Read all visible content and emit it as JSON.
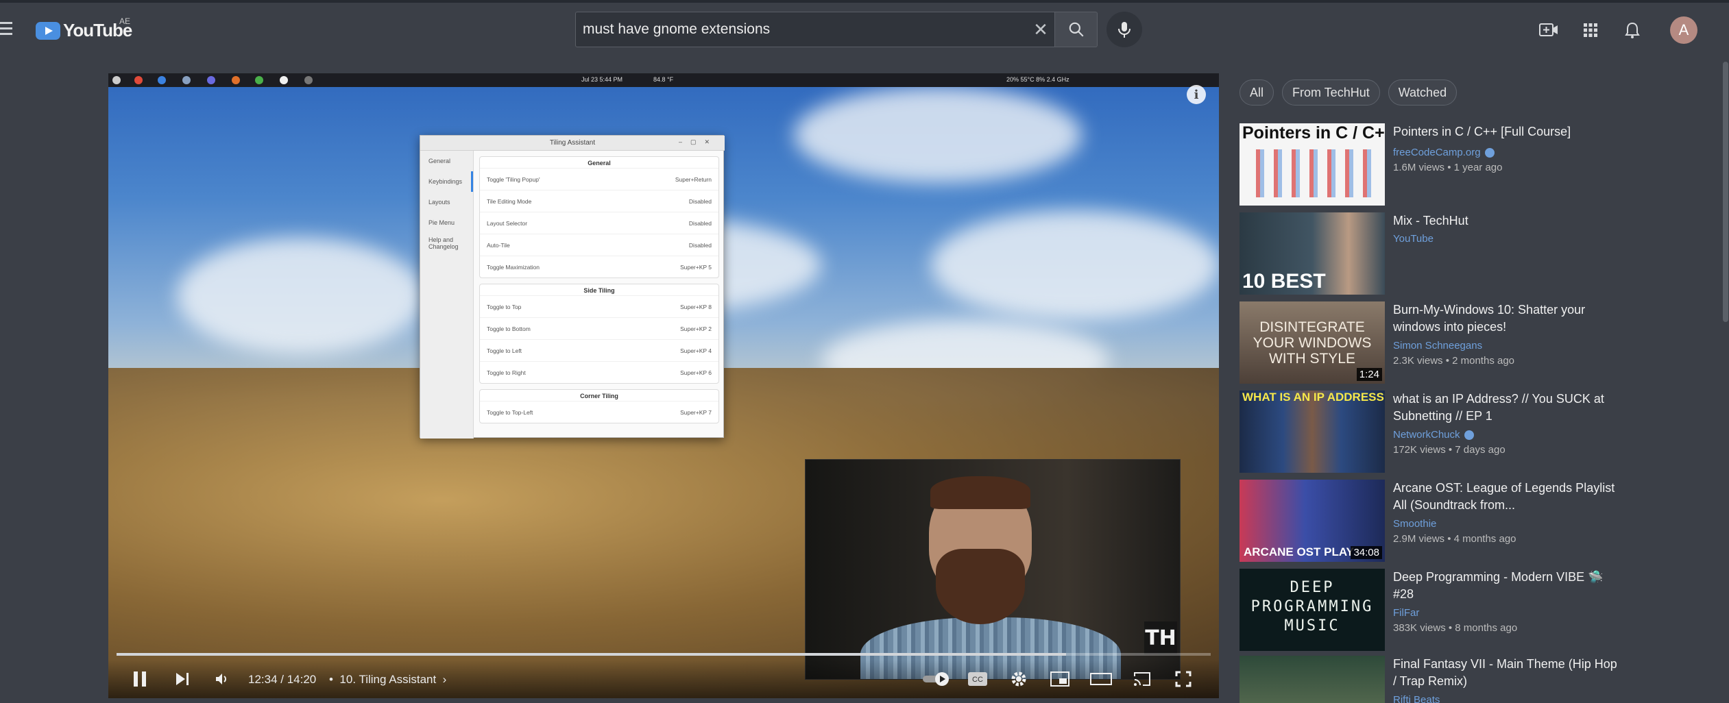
{
  "header": {
    "logo_text": "YouTube",
    "country_code": "AE",
    "search_query": "must have gnome extensions",
    "avatar_letter": "A",
    "icons": [
      "menu-icon",
      "search-icon",
      "clear-icon",
      "mic-icon",
      "create-icon",
      "apps-icon",
      "notifications-icon"
    ]
  },
  "video": {
    "desktop_bar": {
      "clock": "Jul 23  5:44 PM",
      "weather": "84.8 °F",
      "stats": "20%   55°C   8%   2.4 GHz"
    },
    "tiling_window": {
      "title": "Tiling Assistant",
      "nav": [
        "General",
        "Keybindings",
        "Layouts",
        "Pie Menu",
        "Help and Changelog"
      ],
      "sections": [
        {
          "heading": "General",
          "rows": [
            {
              "label": "Toggle 'Tiling Popup'",
              "value": "Super+Return"
            },
            {
              "label": "Tile Editing Mode",
              "value": "Disabled"
            },
            {
              "label": "Layout Selector",
              "value": "Disabled"
            },
            {
              "label": "Auto-Tile",
              "value": "Disabled"
            },
            {
              "label": "Toggle Maximization",
              "value": "Super+KP 5"
            }
          ]
        },
        {
          "heading": "Side Tiling",
          "rows": [
            {
              "label": "Toggle to Top",
              "value": "Super+KP 8"
            },
            {
              "label": "Toggle to Bottom",
              "value": "Super+KP 2"
            },
            {
              "label": "Toggle to Left",
              "value": "Super+KP 4"
            },
            {
              "label": "Toggle to Right",
              "value": "Super+KP 6"
            }
          ]
        },
        {
          "heading": "Corner Tiling",
          "rows": [
            {
              "label": "Toggle to Top-Left",
              "value": "Super+KP 7"
            }
          ]
        }
      ]
    },
    "watermark": "TH",
    "progress_fraction": 0.868,
    "time": "12:34 / 14:20",
    "chapter": "10. Tiling Assistant"
  },
  "chips": [
    "All",
    "From TechHut",
    "Watched"
  ],
  "recommendations": [
    {
      "title": "Pointers in C / C++ [Full Course]",
      "channel": "freeCodeCamp.org",
      "verified": true,
      "meta": "1.6M views • 1 year ago",
      "duration": "",
      "thumb_text": "Pointers in C / C++"
    },
    {
      "title": "Mix - TechHut",
      "channel": "YouTube",
      "verified": false,
      "meta": "",
      "duration": "",
      "thumb_text": "10 BEST"
    },
    {
      "title": "Burn-My-Windows 10: Shatter your windows into pieces!",
      "channel": "Simon Schneegans",
      "verified": false,
      "meta": "2.3K views • 2 months ago",
      "duration": "1:24",
      "thumb_text": "DISINTEGRATE YOUR WINDOWS WITH STYLE"
    },
    {
      "title": "what is an IP Address? // You SUCK at Subnetting // EP 1",
      "channel": "NetworkChuck",
      "verified": true,
      "meta": "172K views • 7 days ago",
      "duration": "",
      "thumb_text": "WHAT IS AN IP ADDRESS?"
    },
    {
      "title": "Arcane OST: League of Legends Playlist All (Soundtrack from...",
      "channel": "Smoothie",
      "verified": false,
      "meta": "2.9M views • 4 months ago",
      "duration": "34:08",
      "thumb_text": "ARCANE OST PLAY"
    },
    {
      "title": "Deep Programming - Modern VIBE 🛸 #28",
      "channel": "FilFar",
      "verified": false,
      "meta": "383K views • 8 months ago",
      "duration": "",
      "thumb_text": "DEEP PROGRAMMING MUSIC"
    },
    {
      "title": "Final Fantasy VII - Main Theme (Hip Hop / Trap Remix)",
      "channel": "Rifti Beats",
      "verified": false,
      "meta": "",
      "duration": "",
      "thumb_text": ""
    }
  ],
  "colors": {
    "background": "#3b3f47",
    "link": "#6fa0dc",
    "logo": "#4a8fe0"
  }
}
